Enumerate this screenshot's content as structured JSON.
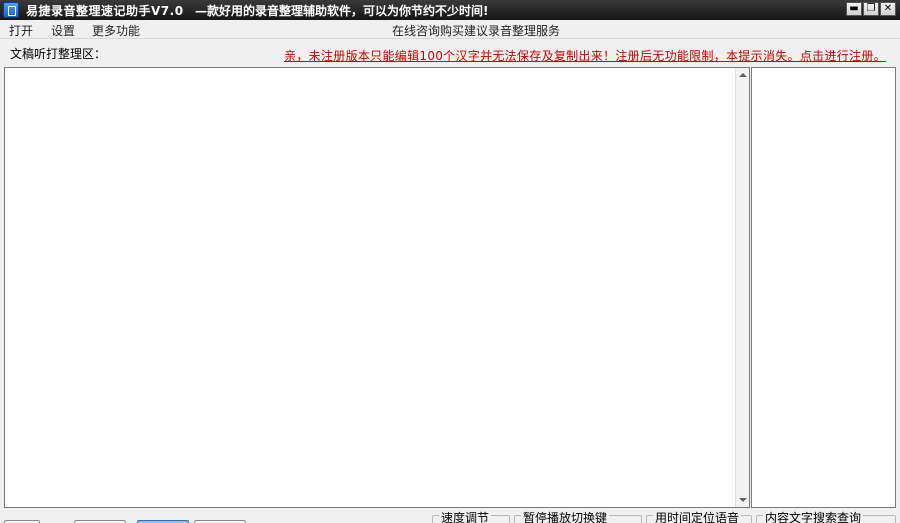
{
  "titlebar": {
    "app_name": "易捷录音整理速记助手V7.0",
    "slogan": "—款好用的录音整理辅助软件，可以为你节约不少时间!",
    "minimize": "▬",
    "restore": "❐",
    "close": "✕"
  },
  "menu": {
    "open": "打开",
    "settings": "设置",
    "more": "更多功能",
    "consult": "在线咨询购买建议",
    "service": "录音整理服务"
  },
  "editor_area": {
    "label": "文稿听打整理区：",
    "notice": "亲，未注册版本只能编辑100个汉字并无法保存及复制出来！注册后无功能限制，本提示消失。点击进行注册。",
    "content": ""
  },
  "bottom_groups": {
    "speed": "速度调节",
    "pause_key": "暂停播放切换键",
    "locate": "用时间定位语音",
    "search": "内容文字搜索查询"
  },
  "icons": {
    "app": "app-icon",
    "scroll_up": "scroll-up-arrow-icon",
    "scroll_down": "scroll-down-arrow-icon"
  },
  "colors": {
    "titlebar": "#1e1e1e",
    "notice": "#cc0000",
    "background": "#f0f0f0"
  }
}
